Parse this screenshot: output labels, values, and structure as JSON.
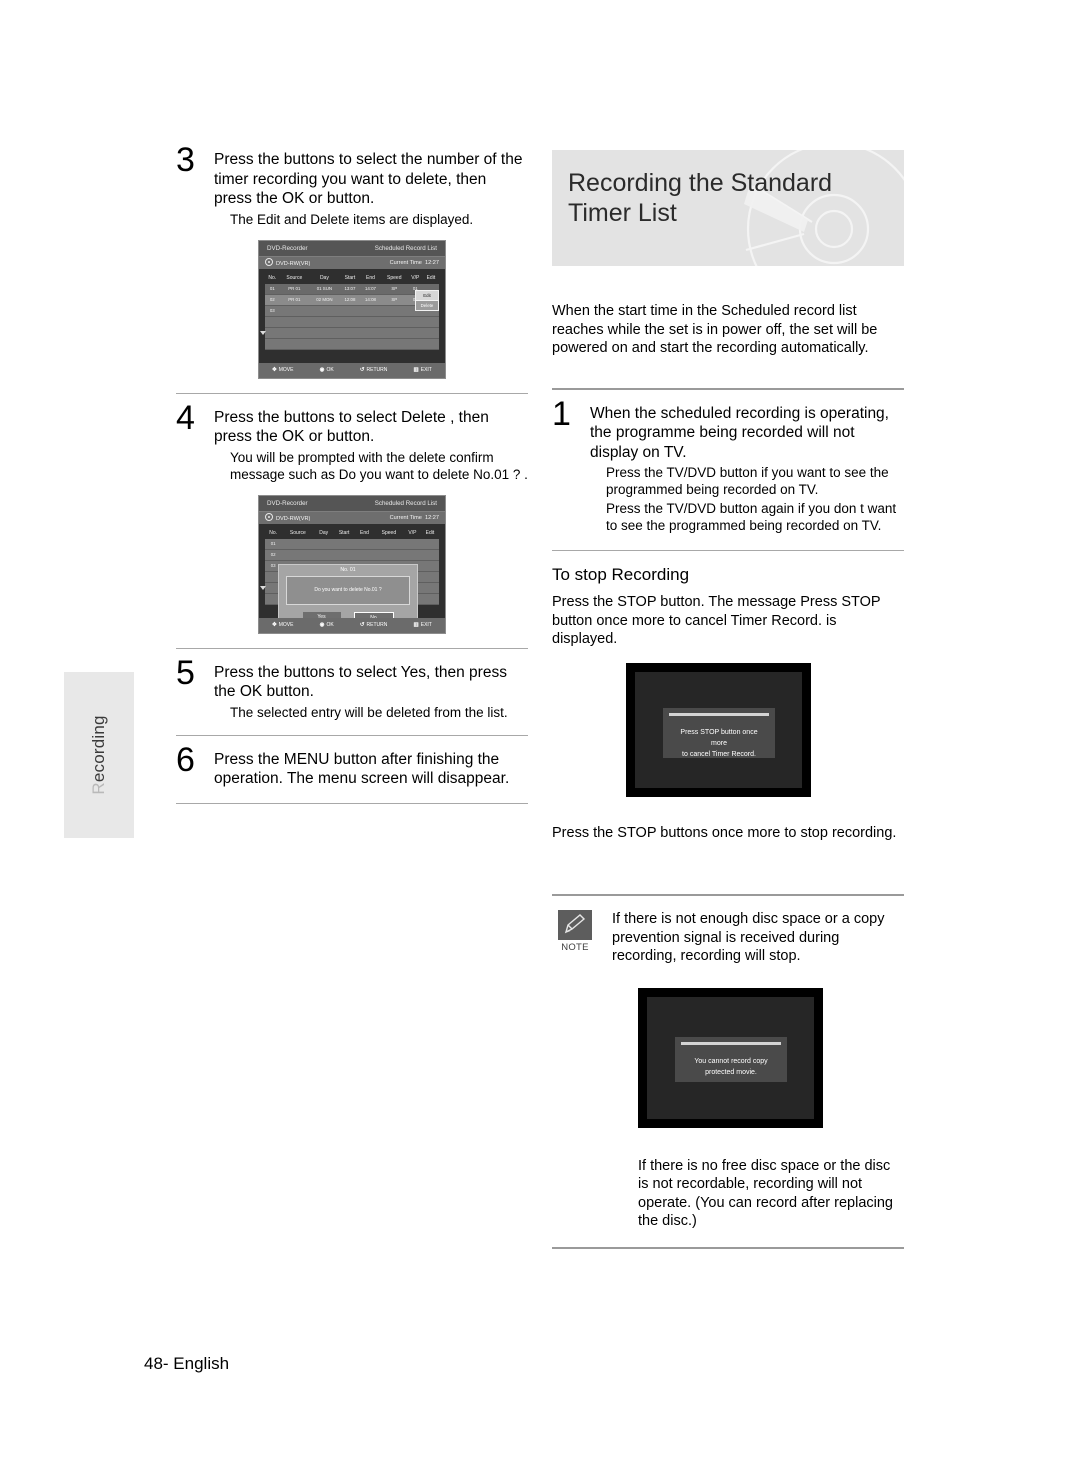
{
  "side_tab": {
    "label": "Recording",
    "first_letter": "R",
    "rest": "ecording"
  },
  "footer": {
    "page": "48- English"
  },
  "left_column": {
    "steps": [
      {
        "number": "3",
        "main": "Press the       buttons to select the number of the timer recording you want to delete, then press the OK or     button.",
        "sub": "The Edit  and Delete  items are displayed."
      },
      {
        "number": "4",
        "main": "Press the        buttons to select Delete , then press the OK or     button.",
        "sub": "You will be prompted with the delete confirm message such as  Do you want to delete  No.01 ? ."
      },
      {
        "number": "5",
        "main": "Press the        buttons to select Yes, then press the OK button.",
        "sub": "The selected entry will be deleted from the list."
      },
      {
        "number": "6",
        "main": "Press the MENU button after finishing the operation. The menu screen will disappear.",
        "sub": ""
      }
    ]
  },
  "osd_list": {
    "device": "DVD-Recorder",
    "screen_title": "Scheduled Record List",
    "disc_type": "DVD-RW(VR)",
    "current_time_label": "Current Time",
    "current_time_value": "12:27",
    "columns": [
      "No.",
      "Source",
      "Day",
      "Start",
      "End",
      "Speed",
      "V/P",
      "Edit"
    ],
    "rows": [
      {
        "no": "01",
        "source": "PR 01",
        "day": "01 SUN",
        "start": "13:07",
        "end": "14:07",
        "speed": "SP",
        "vp": "01"
      },
      {
        "no": "02",
        "source": "PR 01",
        "day": "02 MON",
        "start": "12:08",
        "end": "14:08",
        "speed": "SP",
        "vp": "01"
      },
      {
        "no": "03",
        "source": "",
        "day": "",
        "start": "",
        "end": "",
        "speed": "",
        "vp": ""
      }
    ],
    "popup_menu": {
      "edit": "Edit",
      "delete": "Delete"
    },
    "footbar": {
      "move": "MOVE",
      "ok": "OK",
      "return": "RETURN",
      "exit": "EXIT"
    }
  },
  "osd_confirm": {
    "device": "DVD-Recorder",
    "screen_title": "Scheduled Record List",
    "disc_type": "DVD-RW(VR)",
    "current_time_label": "Current Time",
    "current_time_value": "12:27",
    "columns": [
      "No.",
      "Source",
      "Day",
      "Start",
      "End",
      "Speed",
      "V/P",
      "Edit"
    ],
    "row_numbers": [
      "01",
      "02",
      "03"
    ],
    "dialog": {
      "title": "No. 01",
      "message": "Do you want to delete  No.01  ?",
      "yes": "Yes",
      "no": "No"
    },
    "footbar": {
      "move": "MOVE",
      "ok": "OK",
      "return": "RETURN",
      "exit": "EXIT"
    }
  },
  "right_column": {
    "heading_line1": "Recording the Standard",
    "heading_line2": "Timer List",
    "intro": "When the start time in the Scheduled record list reaches while the set is in power off, the set will be powered on and start the recording automatically.",
    "step1": {
      "number": "1",
      "main": "When the scheduled recording is operating, the programme being recorded will not display on TV.",
      "sub1": "Press the TV/DVD button if you want to see the programmed being recorded on TV.",
      "sub2": "Press the TV/DVD button again if you don t want to see the programmed being recorded on TV."
    },
    "stop_section": {
      "title": "To stop Recording",
      "body": "Press the STOP button. The message  Press STOP button once more to cancel Timer Record.  is displayed.",
      "after_screen_text": "Press the STOP buttons once more to stop recording."
    },
    "tv_message_1": {
      "line1": "Press STOP button once more",
      "line2": "to cancel Timer Record."
    },
    "tv_message_2": {
      "line1": "You cannot record copy protected movie."
    },
    "note": {
      "label": "NOTE",
      "text": "If there is not enough disc space or a copy prevention signal is received during recording, recording will stop."
    },
    "closing": "If there is no free disc space or the disc is not recordable, recording will not operate. (You can record after replacing the disc.)"
  }
}
